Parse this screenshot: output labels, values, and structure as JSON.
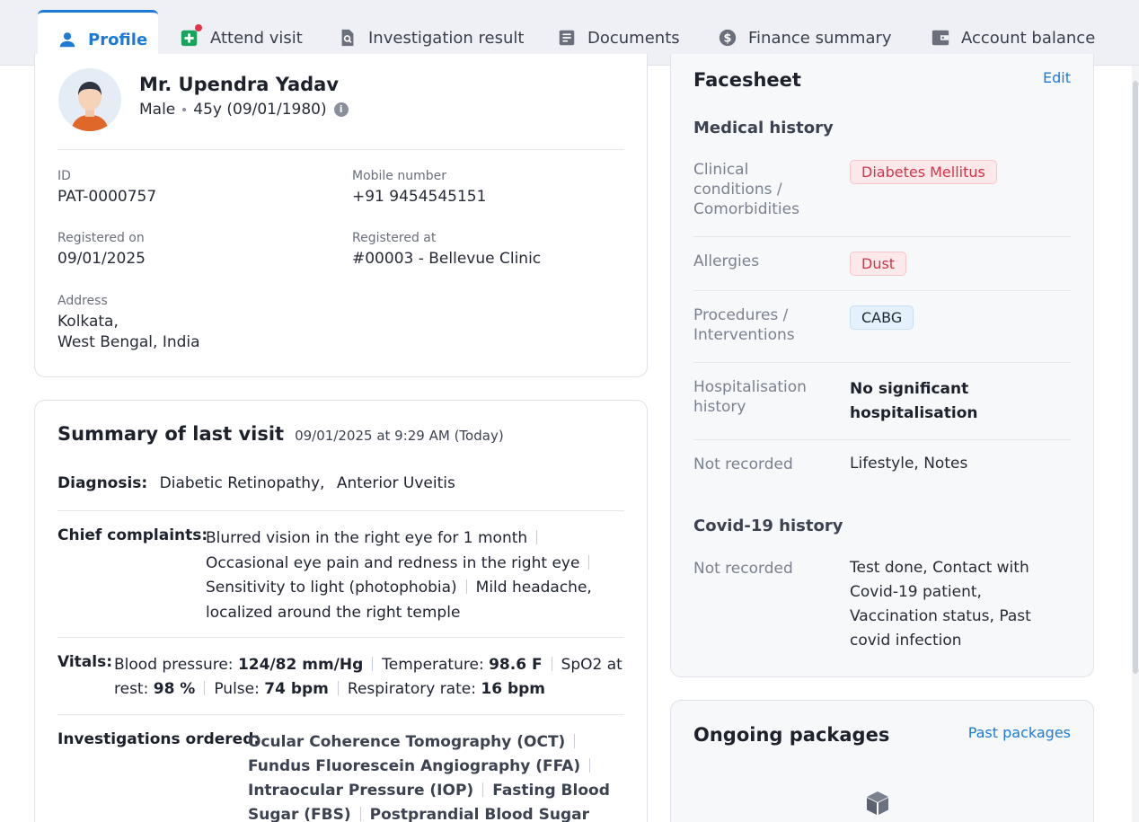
{
  "tabs": [
    {
      "label": "Profile",
      "icon": "person-icon",
      "active": true
    },
    {
      "label": "Attend visit",
      "icon": "medical-plus-icon"
    },
    {
      "label": "Investigation result",
      "icon": "document-search-icon"
    },
    {
      "label": "Documents",
      "icon": "document-icon"
    },
    {
      "label": "Finance summary",
      "icon": "dollar-icon"
    },
    {
      "label": "Account balance",
      "icon": "wallet-icon"
    }
  ],
  "patient": {
    "name": "Mr. Upendra Yadav",
    "gender": "Male",
    "age": "45y (09/01/1980)",
    "id_label": "ID",
    "id": "PAT-0000757",
    "mobile_label": "Mobile number",
    "mobile": "+91 9454545151",
    "registered_on_label": "Registered on",
    "registered_on": "09/01/2025",
    "registered_at_label": "Registered at",
    "registered_at": "#00003 - Bellevue Clinic",
    "address_label": "Address",
    "address_line1": "Kolkata,",
    "address_line2": "West Bengal, India"
  },
  "summary": {
    "title": "Summary of last visit",
    "datetime": "09/01/2025 at 9:29 AM (Today)",
    "diagnosis_label": "Diagnosis:",
    "diagnosis": [
      "Diabetic Retinopathy,",
      "Anterior Uveitis"
    ],
    "complaints_label": "Chief complaints:",
    "complaints": [
      "Blurred vision in the right eye for 1 month",
      "Occasional eye pain and redness in the right eye",
      "Sensitivity to light (photophobia)",
      "Mild headache,",
      "localized around the right temple"
    ],
    "vitals_label": "Vitals:",
    "vitals": [
      {
        "name": "Blood pressure:",
        "value": "124/82 mm/Hg"
      },
      {
        "name": "Temperature:",
        "value": "98.6 F"
      },
      {
        "name": "SpO2 at",
        "value": ""
      },
      {
        "name": "rest:",
        "value": "98 %"
      },
      {
        "name": "Pulse:",
        "value": "74 bpm"
      },
      {
        "name": "Respiratory rate:",
        "value": "16 bpm"
      }
    ],
    "investigations_label": "Investigations ordered:",
    "investigations": [
      "Ocular Coherence Tomography (OCT)",
      "Fundus Fluorescein Angiography (FFA)",
      "Intraocular Pressure (IOP)",
      "Fasting Blood",
      "Sugar (FBS)",
      "Postprandial Blood Sugar"
    ]
  },
  "facesheet": {
    "title": "Facesheet",
    "edit": "Edit",
    "medical_history": "Medical history",
    "rows": [
      {
        "label": "Clinical conditions / Comorbidities",
        "tag": "Diabetes Mellitus",
        "tag_color": "red"
      },
      {
        "label": "Allergies",
        "tag": "Dust",
        "tag_color": "red"
      },
      {
        "label": "Procedures / Interventions",
        "tag": "CABG",
        "tag_color": "blue"
      },
      {
        "label": "Hospitalisation history",
        "value": "No significant hospitalisation"
      },
      {
        "label": "Not recorded",
        "value": "Lifestyle, Notes"
      }
    ],
    "covid_title": "Covid-19 history",
    "covid_label": "Not recorded",
    "covid_value": "Test done, Contact with Covid-19 patient, Vaccination status, Past covid infection"
  },
  "packages": {
    "title": "Ongoing packages",
    "link": "Past packages",
    "icon": "box-icon"
  },
  "colors": {
    "accent": "#1c7bd8",
    "danger": "#e3344a",
    "success": "#1aa35a"
  }
}
